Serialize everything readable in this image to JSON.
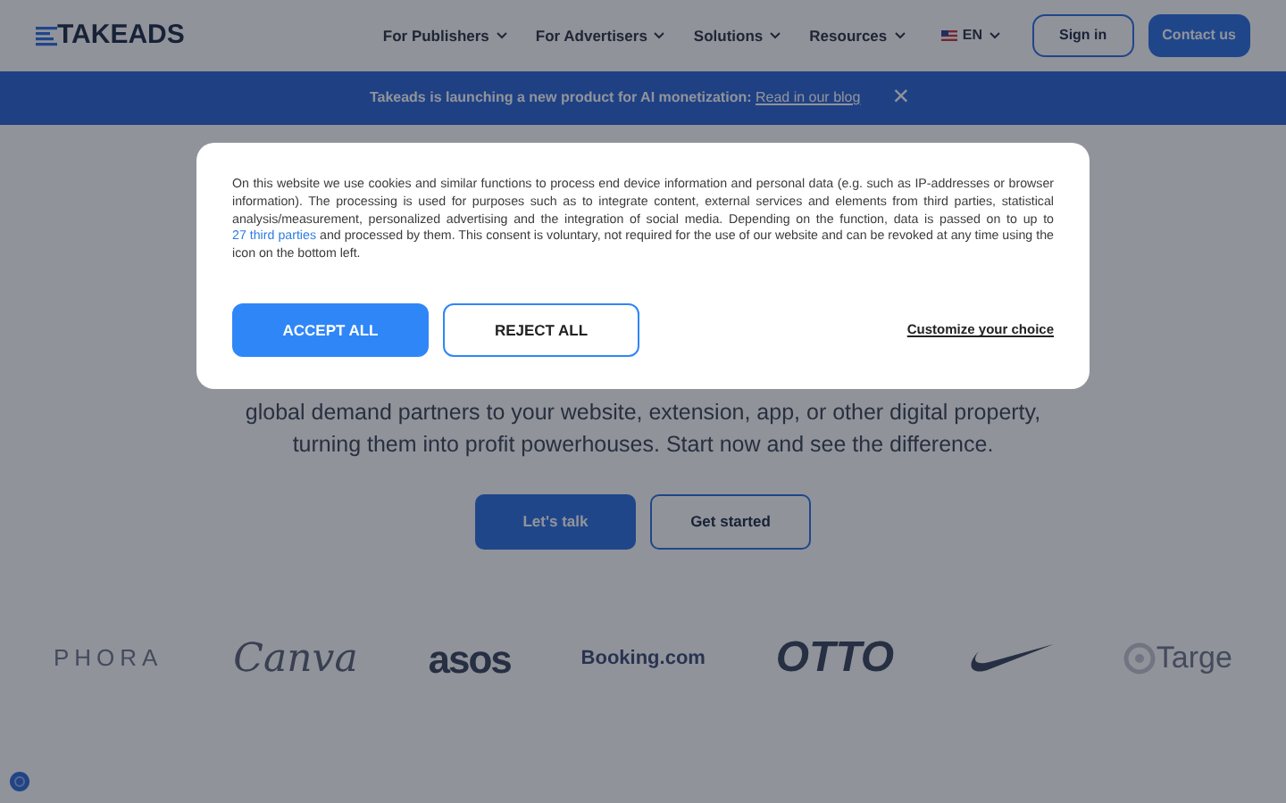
{
  "header": {
    "logo": "TAKEADS",
    "nav": [
      {
        "label": "For Publishers"
      },
      {
        "label": "For Advertisers"
      },
      {
        "label": "Solutions"
      },
      {
        "label": "Resources"
      }
    ],
    "language": "EN",
    "sign_in": "Sign in",
    "contact": "Contact us"
  },
  "banner": {
    "text": "Takeads is launching a new product for AI monetization:",
    "link": "Read in our blog",
    "close": "×"
  },
  "hero": {
    "text": "global demand partners to your website, extension, app, or other digital property, turning them into profit powerhouses. Start now and see the difference.",
    "buttons": [
      {
        "label": "Let's talk",
        "kind": "primary"
      },
      {
        "label": "Get started",
        "kind": "outline"
      }
    ]
  },
  "logos": [
    {
      "kind": "spaced",
      "label": "PHORA"
    },
    {
      "kind": "script",
      "label": "Canva"
    },
    {
      "kind": "heavy",
      "label": "asos"
    },
    {
      "kind": "plain",
      "label": "Booking.com"
    },
    {
      "kind": "italic",
      "label": "OTTO"
    },
    {
      "kind": "swoosh"
    },
    {
      "kind": "target",
      "label": "Targe"
    }
  ],
  "cookie_dialog": {
    "text_before": "On this website we use cookies and similar functions to process end device information and personal data (e.g. such as IP-addresses or browser information). The processing is used for purposes such as to integrate content, external services and elements from third parties, statistical analysis/measurement, personalized advertising and the integration of social media. Depending on the function, data is passed on to up to ",
    "link": "27 third parties",
    "text_after": " and processed by them. This consent is voluntary, not required for the use of our website and can be revoked at any time using the icon on the bottom left.",
    "accept": "ACCEPT ALL",
    "reject": "REJECT ALL",
    "customize": "Customize your choice"
  }
}
